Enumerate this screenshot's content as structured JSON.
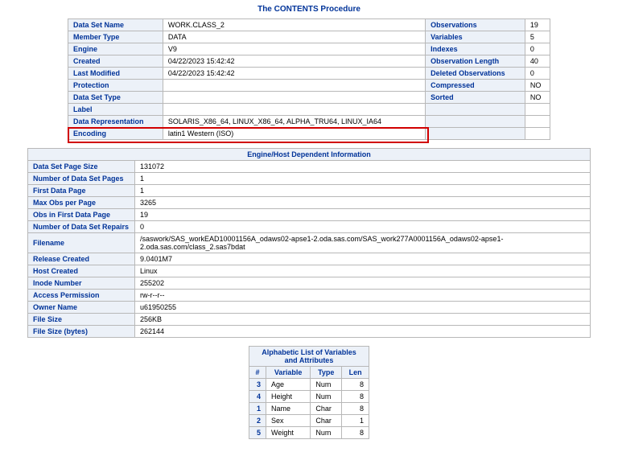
{
  "title": "The CONTENTS Procedure",
  "meta": {
    "rows": [
      {
        "l1": "Data Set Name",
        "v1": "WORK.CLASS_2",
        "l2": "Observations",
        "v2": "19"
      },
      {
        "l1": "Member Type",
        "v1": "DATA",
        "l2": "Variables",
        "v2": "5"
      },
      {
        "l1": "Engine",
        "v1": "V9",
        "l2": "Indexes",
        "v2": "0"
      },
      {
        "l1": "Created",
        "v1": "04/22/2023 15:42:42",
        "l2": "Observation Length",
        "v2": "40"
      },
      {
        "l1": "Last Modified",
        "v1": "04/22/2023 15:42:42",
        "l2": "Deleted Observations",
        "v2": "0"
      },
      {
        "l1": "Protection",
        "v1": "",
        "l2": "Compressed",
        "v2": "NO"
      },
      {
        "l1": "Data Set Type",
        "v1": "",
        "l2": "Sorted",
        "v2": "NO"
      },
      {
        "l1": "Label",
        "v1": "",
        "l2": "",
        "v2": ""
      },
      {
        "l1": "Data Representation",
        "v1": "SOLARIS_X86_64, LINUX_X86_64, ALPHA_TRU64, LINUX_IA64",
        "l2": "",
        "v2": ""
      },
      {
        "l1": "Encoding",
        "v1": "latin1 Western (ISO)",
        "l2": "",
        "v2": ""
      }
    ]
  },
  "engine": {
    "header": "Engine/Host Dependent Information",
    "rows": [
      {
        "l": "Data Set Page Size",
        "v": "131072"
      },
      {
        "l": "Number of Data Set Pages",
        "v": "1"
      },
      {
        "l": "First Data Page",
        "v": "1"
      },
      {
        "l": "Max Obs per Page",
        "v": "3265"
      },
      {
        "l": "Obs in First Data Page",
        "v": "19"
      },
      {
        "l": "Number of Data Set Repairs",
        "v": "0"
      },
      {
        "l": "Filename",
        "v": "/saswork/SAS_workEAD10001156A_odaws02-apse1-2.oda.sas.com/SAS_work277A0001156A_odaws02-apse1-2.oda.sas.com/class_2.sas7bdat"
      },
      {
        "l": "Release Created",
        "v": "9.0401M7"
      },
      {
        "l": "Host Created",
        "v": "Linux"
      },
      {
        "l": "Inode Number",
        "v": "255202"
      },
      {
        "l": "Access Permission",
        "v": "rw-r--r--"
      },
      {
        "l": "Owner Name",
        "v": "u61950255"
      },
      {
        "l": "File Size",
        "v": "256KB"
      },
      {
        "l": "File Size (bytes)",
        "v": "262144"
      }
    ]
  },
  "vars": {
    "header": "Alphabetic List of Variables and Attributes",
    "cols": {
      "num": "#",
      "var": "Variable",
      "type": "Type",
      "len": "Len"
    },
    "rows": [
      {
        "n": "3",
        "var": "Age",
        "type": "Num",
        "len": "8"
      },
      {
        "n": "4",
        "var": "Height",
        "type": "Num",
        "len": "8"
      },
      {
        "n": "1",
        "var": "Name",
        "type": "Char",
        "len": "8"
      },
      {
        "n": "2",
        "var": "Sex",
        "type": "Char",
        "len": "1"
      },
      {
        "n": "5",
        "var": "Weight",
        "type": "Num",
        "len": "8"
      }
    ]
  }
}
